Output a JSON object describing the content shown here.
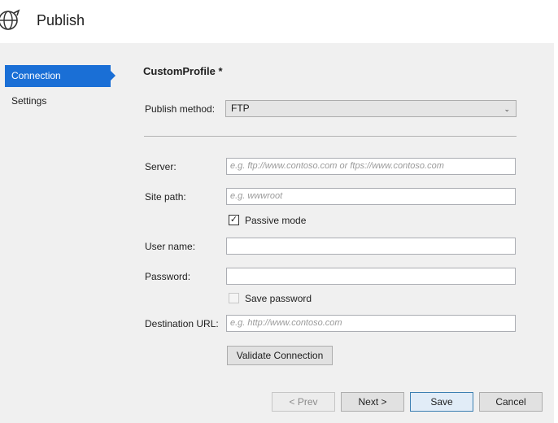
{
  "window": {
    "title": "Publish",
    "icon": "globe-publish-icon"
  },
  "nav": {
    "items": [
      {
        "label": "Connection",
        "selected": true
      },
      {
        "label": "Settings",
        "selected": false
      }
    ]
  },
  "profile": {
    "name": "CustomProfile *"
  },
  "form": {
    "publish_method": {
      "label": "Publish method:",
      "value": "FTP"
    },
    "server": {
      "label": "Server:",
      "value": "",
      "placeholder": "e.g. ftp://www.contoso.com or ftps://www.contoso.com"
    },
    "site_path": {
      "label": "Site path:",
      "value": "",
      "placeholder": "e.g. wwwroot"
    },
    "passive_mode": {
      "label": "Passive mode",
      "checked": true
    },
    "user_name": {
      "label": "User name:",
      "value": ""
    },
    "password": {
      "label": "Password:",
      "value": ""
    },
    "save_password": {
      "label": "Save password",
      "checked": false,
      "enabled": false
    },
    "destination_url": {
      "label": "Destination URL:",
      "value": "",
      "placeholder": "e.g. http://www.contoso.com"
    },
    "validate_label": "Validate Connection"
  },
  "footer": {
    "prev_label": "< Prev",
    "next_label": "Next >",
    "save_label": "Save",
    "cancel_label": "Cancel"
  },
  "colors": {
    "accent": "#1a6fd6",
    "header_bg": "#ffffff",
    "body_bg": "#f0f0f0"
  }
}
